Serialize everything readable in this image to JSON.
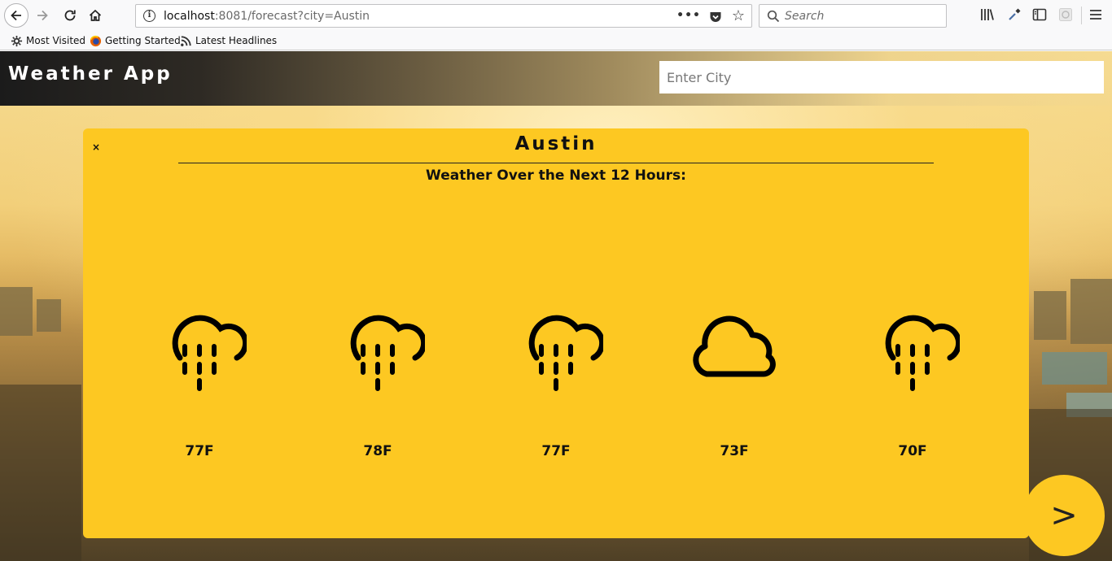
{
  "browser": {
    "url_host": "localhost",
    "url_rest": ":8081/forecast?city=Austin",
    "search_placeholder": "Search",
    "bookmarks": [
      {
        "label": "Most Visited",
        "icon": "gear-icon"
      },
      {
        "label": "Getting Started",
        "icon": "firefox-icon"
      },
      {
        "label": "Latest Headlines",
        "icon": "rss-icon"
      }
    ]
  },
  "app": {
    "title": "Weather App",
    "search_placeholder": "Enter City"
  },
  "card": {
    "close_label": "×",
    "city": "Austin",
    "subtitle": "Weather Over the Next 12 Hours:",
    "forecast": [
      {
        "icon": "rain-icon",
        "temp": "77F"
      },
      {
        "icon": "rain-icon",
        "temp": "78F"
      },
      {
        "icon": "rain-icon",
        "temp": "77F"
      },
      {
        "icon": "cloud-icon",
        "temp": "73F"
      },
      {
        "icon": "rain-icon",
        "temp": "70F"
      }
    ]
  },
  "next_button": {
    "label": ">"
  },
  "colors": {
    "card": "#fdc822",
    "header_dark": "#1b1b1b",
    "icon": "#000000"
  }
}
